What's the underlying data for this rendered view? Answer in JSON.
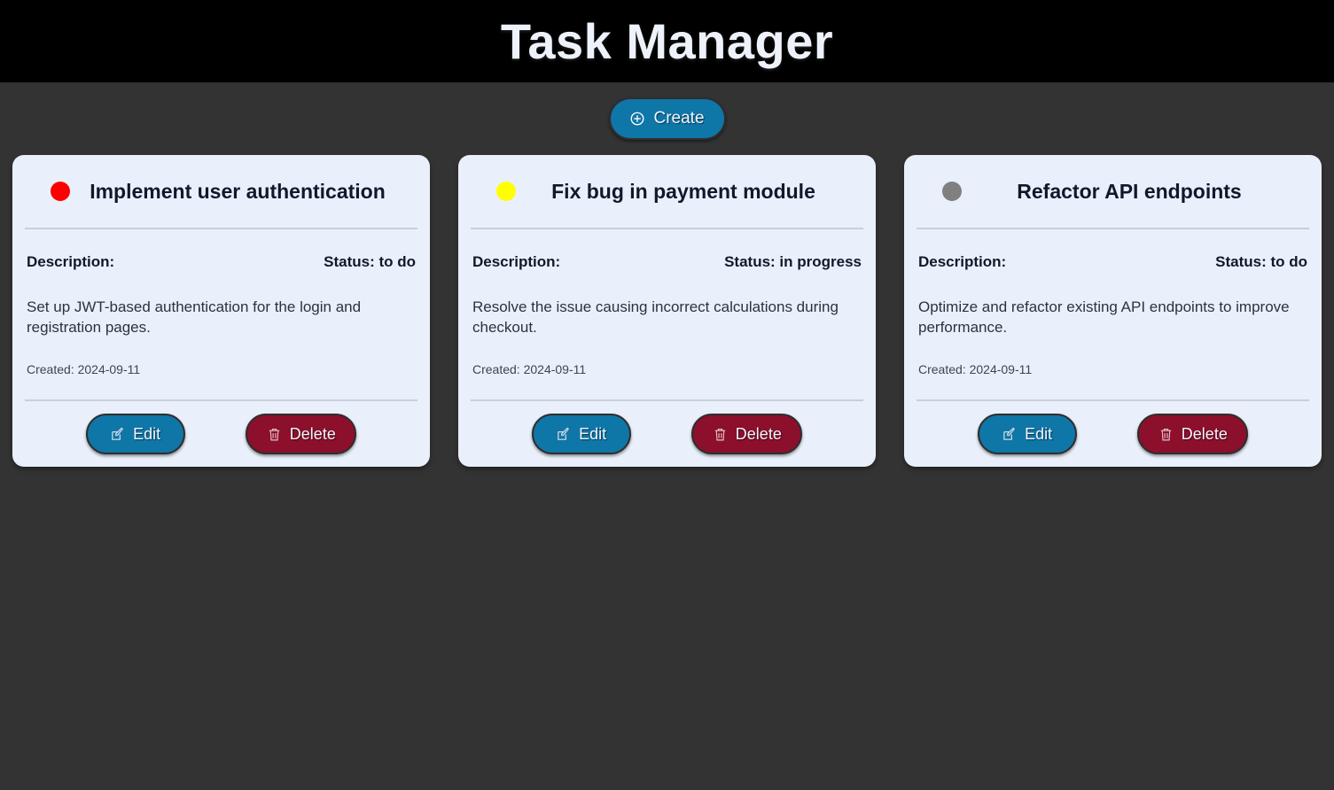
{
  "header": {
    "title": "Task Manager"
  },
  "toolbar": {
    "create_label": "Create",
    "create_icon": "plus-circle-icon"
  },
  "labels": {
    "description": "Description:",
    "edit": "Edit",
    "delete": "Delete",
    "edit_icon": "pencil-square-icon",
    "delete_icon": "trash-icon"
  },
  "colors": {
    "header_bg": "#000000",
    "page_bg": "#333333",
    "card_bg": "#eaf0fb",
    "accent_blue": "#0f76a8",
    "danger_red": "#8c0f2c",
    "dot_todo": "#ff0000",
    "dot_in_progress": "#ffff00",
    "dot_done": "#808080"
  },
  "tasks": [
    {
      "title": "Implement user authentication",
      "status_label": "Status: to do",
      "status_color": "#ff0000",
      "description": "Set up JWT-based authentication for the login and registration pages.",
      "created": "Created: 2024-09-11"
    },
    {
      "title": "Fix bug in payment module",
      "status_label": "Status: in progress",
      "status_color": "#ffff00",
      "description": "Resolve the issue causing incorrect calculations during checkout.",
      "created": "Created: 2024-09-11"
    },
    {
      "title": "Refactor API endpoints",
      "status_label": "Status: to do",
      "status_color": "#808080",
      "description": "Optimize and refactor existing API endpoints to improve performance.",
      "created": "Created: 2024-09-11"
    }
  ]
}
